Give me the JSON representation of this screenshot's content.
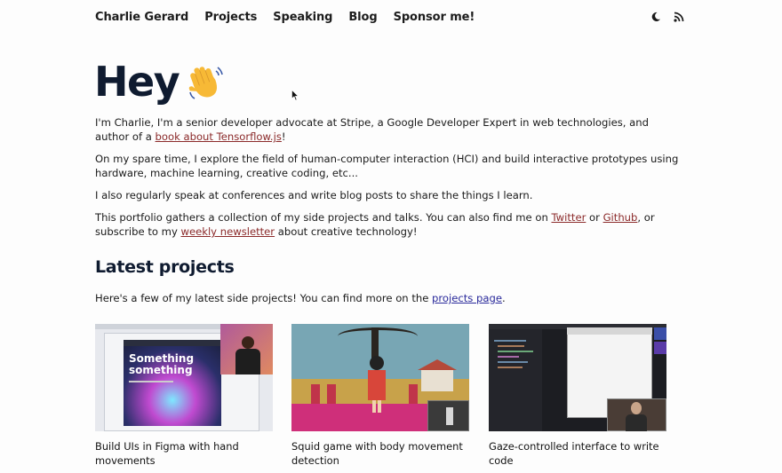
{
  "nav": {
    "brand": "Charlie Gerard",
    "links": [
      "Projects",
      "Speaking",
      "Blog",
      "Sponsor me!"
    ],
    "theme_icon": "moon-icon",
    "rss_icon": "rss-icon"
  },
  "hero": {
    "title": "Hey",
    "emoji": "waving-hand-icon"
  },
  "intro": {
    "p1_before": "I'm Charlie, I'm a senior developer advocate at Stripe, a Google Developer Expert in web technologies, and author of a ",
    "p1_link": "book about Tensorflow.js",
    "p1_after": "!",
    "p2": "On my spare time, I explore the field of human-computer interaction (HCI) and build interactive prototypes using hardware, machine learning, creative coding, etc...",
    "p3": "I also regularly speak at conferences and write blog posts to share the things I learn.",
    "p4_before": "This portfolio gathers a collection of my side projects and talks. You can also find me on ",
    "p4_link_twitter": "Twitter",
    "p4_mid1": " or ",
    "p4_link_github": "Github",
    "p4_mid2": ", or subscribe to my ",
    "p4_link_newsletter": "weekly newsletter",
    "p4_after": " about creative technology!"
  },
  "latest": {
    "title": "Latest projects",
    "desc_before": "Here's a few of my latest side projects! You can find more on the ",
    "desc_link": "projects page",
    "desc_after": ".",
    "cards": [
      {
        "title": "Build UIs in Figma with hand movements",
        "thumb_text_1": "Something",
        "thumb_text_2": "something"
      },
      {
        "title": "Squid game with body movement detection"
      },
      {
        "title": "Gaze-controlled interface to write code"
      }
    ]
  },
  "colors": {
    "heading": "#0f1b30",
    "link": "#8b2a2a",
    "link_visited": "#2a2a9b"
  }
}
